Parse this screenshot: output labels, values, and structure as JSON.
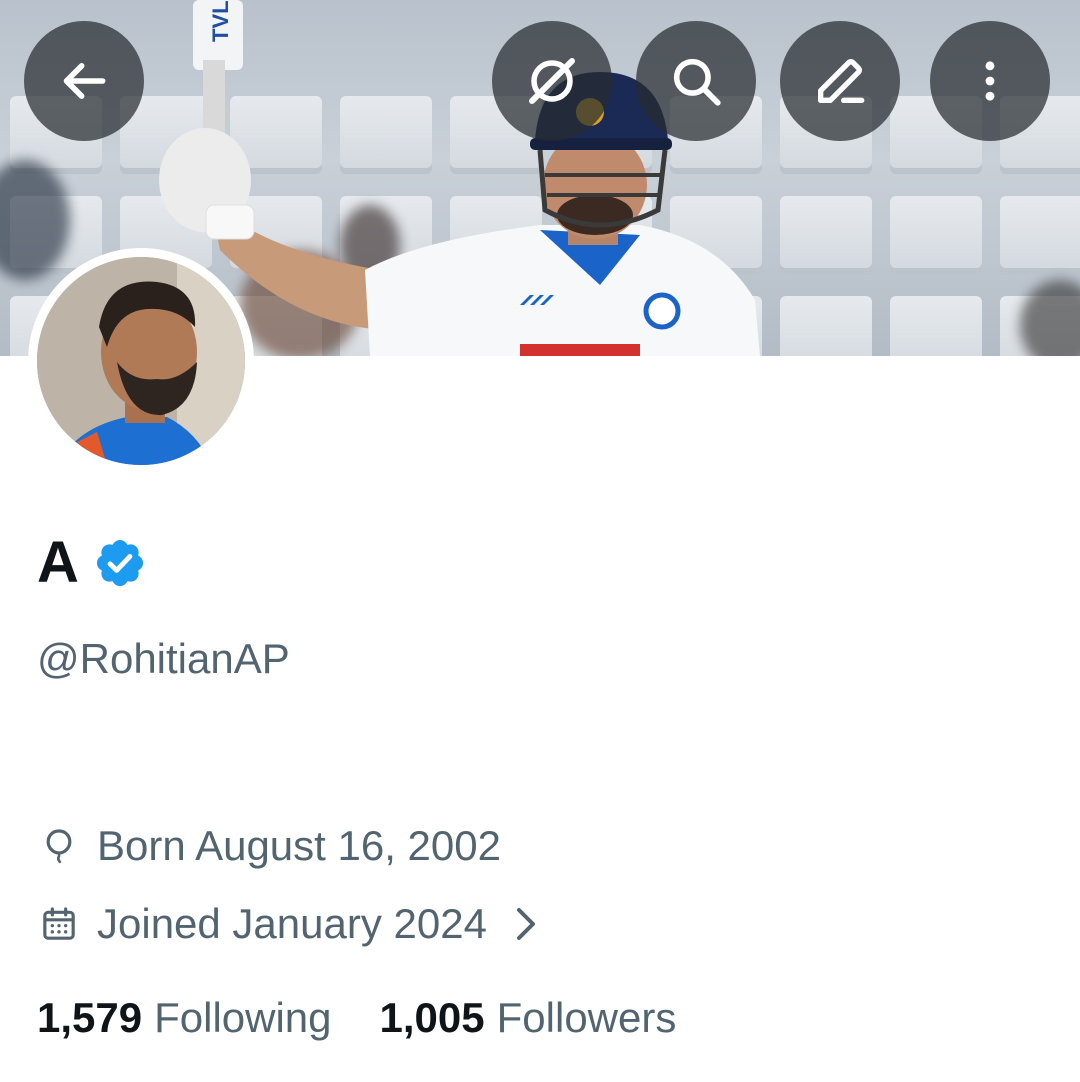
{
  "header": {
    "back_icon": "arrow-left-icon",
    "grok_icon": "grok-icon",
    "search_icon": "search-icon",
    "edit_icon": "pencil-icon",
    "more_icon": "more-vertical-icon"
  },
  "profile": {
    "display_name": "A",
    "verified": true,
    "handle": "@RohitianAP",
    "birthday": "Born August 16, 2002",
    "joined": "Joined January 2024",
    "following_count": "1,579",
    "following_label": "Following",
    "followers_count": "1,005",
    "followers_label": "Followers"
  },
  "colors": {
    "primary_text": "#0f1419",
    "secondary_text": "#536471",
    "verified_blue": "#1d9bf0",
    "button_overlay": "#272c30"
  }
}
